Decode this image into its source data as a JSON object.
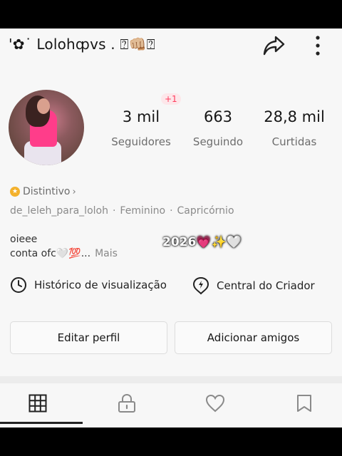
{
  "header": {
    "username": "'✿˙ Lolohȹvs . ⍰👊🏼⍰",
    "share_icon": "share-arrow-icon",
    "more_icon": "more-vertical-icon"
  },
  "profile": {
    "new_badge": "+1",
    "stats": [
      {
        "value": "3 mil",
        "label": "Seguidores"
      },
      {
        "value": "663",
        "label": "Seguindo"
      },
      {
        "value": "28,8 mil",
        "label": "Curtidas"
      }
    ],
    "badge_label": "Distintivo",
    "tags": [
      "de_leleh_para_loloh",
      "Feminino",
      "Capricórnio"
    ],
    "bio_line1": "oieee",
    "bio_line2": "conta ofc🤍💯...",
    "bio_more": "Mais",
    "sticker": "2026💗✨🤍"
  },
  "links": {
    "history": "Histórico de visualização",
    "creator": "Central do Criador"
  },
  "buttons": {
    "edit": "Editar perfil",
    "add_friends": "Adicionar amigos"
  },
  "tabs": {
    "items": [
      "grid-icon",
      "lock-icon",
      "heart-icon",
      "bookmark-icon"
    ],
    "active": "grid-icon"
  }
}
